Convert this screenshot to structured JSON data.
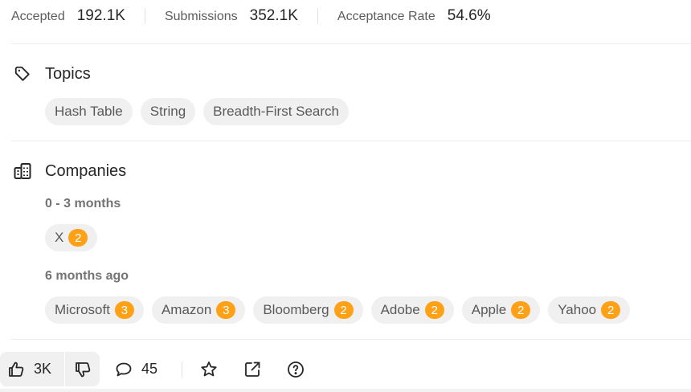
{
  "stats": [
    {
      "label": "Accepted",
      "value": "192.1K"
    },
    {
      "label": "Submissions",
      "value": "352.1K"
    },
    {
      "label": "Acceptance Rate",
      "value": "54.6%"
    }
  ],
  "topics": {
    "title": "Topics",
    "icon": "tag-icon",
    "tags": [
      "Hash Table",
      "String",
      "Breadth-First Search"
    ]
  },
  "companies": {
    "title": "Companies",
    "icon": "building-icon",
    "groups": [
      {
        "period": "0 - 3 months",
        "items": [
          {
            "name": "X",
            "count": "2"
          }
        ]
      },
      {
        "period": "6 months ago",
        "items": [
          {
            "name": "Microsoft",
            "count": "3"
          },
          {
            "name": "Amazon",
            "count": "3"
          },
          {
            "name": "Bloomberg",
            "count": "2"
          },
          {
            "name": "Adobe",
            "count": "2"
          },
          {
            "name": "Apple",
            "count": "2"
          },
          {
            "name": "Yahoo",
            "count": "2"
          }
        ]
      }
    ]
  },
  "actions": {
    "likes": "3K",
    "comments": "45",
    "icons": [
      "thumbs-up-icon",
      "thumbs-down-icon",
      "comment-icon",
      "star-icon",
      "share-icon",
      "help-icon"
    ]
  },
  "colors": {
    "badge": "#ffa116",
    "chip_bg": "#f0f0f0"
  }
}
